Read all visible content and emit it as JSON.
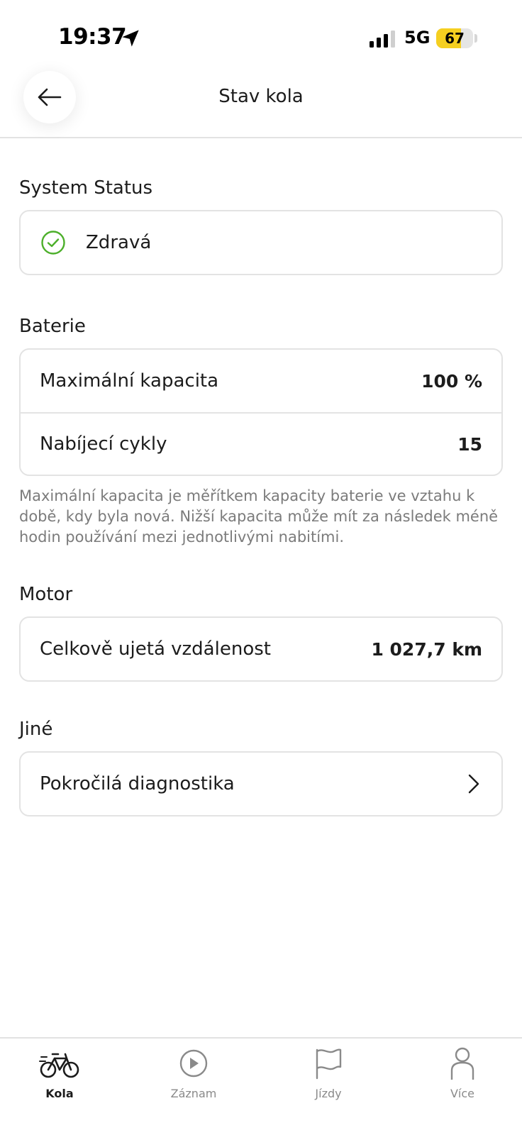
{
  "status_bar": {
    "time": "19:37",
    "network": "5G",
    "battery_level": "67",
    "battery_fraction": 0.67,
    "battery_color": "#f5cf20"
  },
  "header": {
    "title": "Stav kola",
    "back_icon": "arrow-left-icon"
  },
  "system_status": {
    "title": "System Status",
    "status_icon": "check-circle-icon",
    "status_color": "#4caf2a",
    "status_text": "Zdravá"
  },
  "battery": {
    "title": "Baterie",
    "rows": [
      {
        "label": "Maximální kapacita",
        "value": "100 %"
      },
      {
        "label": "Nabíjecí cykly",
        "value": "15"
      }
    ],
    "note": "Maximální kapacita je měřítkem kapacity baterie ve vztahu k době, kdy byla nová. Nižší kapacita může mít za následek méně hodin používání mezi jednotlivými nabitími."
  },
  "motor": {
    "title": "Motor",
    "rows": [
      {
        "label": "Celkově ujetá vzdálenost",
        "value": "1 027,7 km"
      }
    ]
  },
  "other": {
    "title": "Jiné",
    "rows": [
      {
        "label": "Pokročilá diagnostika",
        "icon": "chevron-right-icon"
      }
    ]
  },
  "tab_bar": {
    "tabs": [
      {
        "label": "Kola",
        "icon": "bike-icon",
        "active": true
      },
      {
        "label": "Záznam",
        "icon": "play-icon",
        "active": false
      },
      {
        "label": "Jízdy",
        "icon": "flag-icon",
        "active": false
      },
      {
        "label": "Více",
        "icon": "person-icon",
        "active": false
      }
    ]
  }
}
